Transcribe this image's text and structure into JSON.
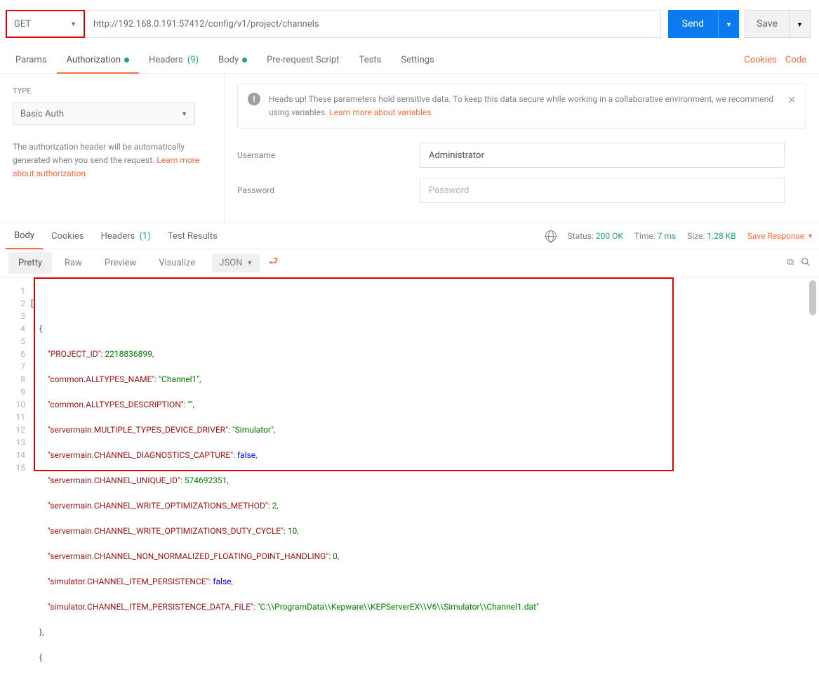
{
  "request": {
    "method": "GET",
    "url": "http://192.168.0.191:57412/config/v1/project/channels",
    "sendLabel": "Send",
    "saveLabel": "Save"
  },
  "reqTabs": {
    "params": "Params",
    "authorization": "Authorization",
    "headers": "Headers",
    "headersCount": "(9)",
    "body": "Body",
    "prerequest": "Pre-request Script",
    "tests": "Tests",
    "settings": "Settings",
    "cookies": "Cookies",
    "code": "Code"
  },
  "auth": {
    "typeLabel": "TYPE",
    "typeValue": "Basic Auth",
    "desc1": "The authorization header will be automatically generated when you send the request. ",
    "descLink": "Learn more about authorization",
    "bannerText": "Heads up! These parameters hold sensitive data. To keep this data secure while working in a collaborative environment, we recommend using variables. ",
    "bannerLink": "Learn more about variables",
    "usernameLabel": "Username",
    "usernameValue": "Administrator",
    "passwordLabel": "Password",
    "passwordPlaceholder": "Password"
  },
  "respTabs": {
    "body": "Body",
    "cookies": "Cookies",
    "headers": "Headers",
    "headersCount": "(1)",
    "testResults": "Test Results"
  },
  "respMeta": {
    "statusLabel": "Status:",
    "statusValue": "200 OK",
    "timeLabel": "Time:",
    "timeValue": "7 ms",
    "sizeLabel": "Size:",
    "sizeValue": "1.28 KB",
    "saveResponse": "Save Response"
  },
  "viewBar": {
    "pretty": "Pretty",
    "raw": "Raw",
    "preview": "Preview",
    "visualize": "Visualize",
    "format": "JSON"
  },
  "code": {
    "lines": [
      "1",
      "2",
      "3",
      "4",
      "5",
      "6",
      "7",
      "8",
      "9",
      "10",
      "11",
      "12",
      "13",
      "14",
      "15"
    ],
    "l1": "[",
    "l2": "    {",
    "l3k": "\"PROJECT_ID\"",
    "l3v": "2218836899",
    "l4k": "\"common.ALLTYPES_NAME\"",
    "l4v": "\"Channel1\"",
    "l5k": "\"common.ALLTYPES_DESCRIPTION\"",
    "l5v": "\"\"",
    "l6k": "\"servermain.MULTIPLE_TYPES_DEVICE_DRIVER\"",
    "l6v": "\"Simulator\"",
    "l7k": "\"servermain.CHANNEL_DIAGNOSTICS_CAPTURE\"",
    "l7v": "false",
    "l8k": "\"servermain.CHANNEL_UNIQUE_ID\"",
    "l8v": "574692351",
    "l9k": "\"servermain.CHANNEL_WRITE_OPTIMIZATIONS_METHOD\"",
    "l9v": "2",
    "l10k": "\"servermain.CHANNEL_WRITE_OPTIMIZATIONS_DUTY_CYCLE\"",
    "l10v": "10",
    "l11k": "\"servermain.CHANNEL_NON_NORMALIZED_FLOATING_POINT_HANDLING\"",
    "l11v": "0",
    "l12k": "\"simulator.CHANNEL_ITEM_PERSISTENCE\"",
    "l12v": "false",
    "l13k": "\"simulator.CHANNEL_ITEM_PERSISTENCE_DATA_FILE\"",
    "l13v": "\"C:\\\\ProgramData\\\\Kepware\\\\KEPServerEX\\\\V6\\\\Simulator\\\\Channel1.dat\"",
    "l14": "    },",
    "l15": "    {"
  }
}
